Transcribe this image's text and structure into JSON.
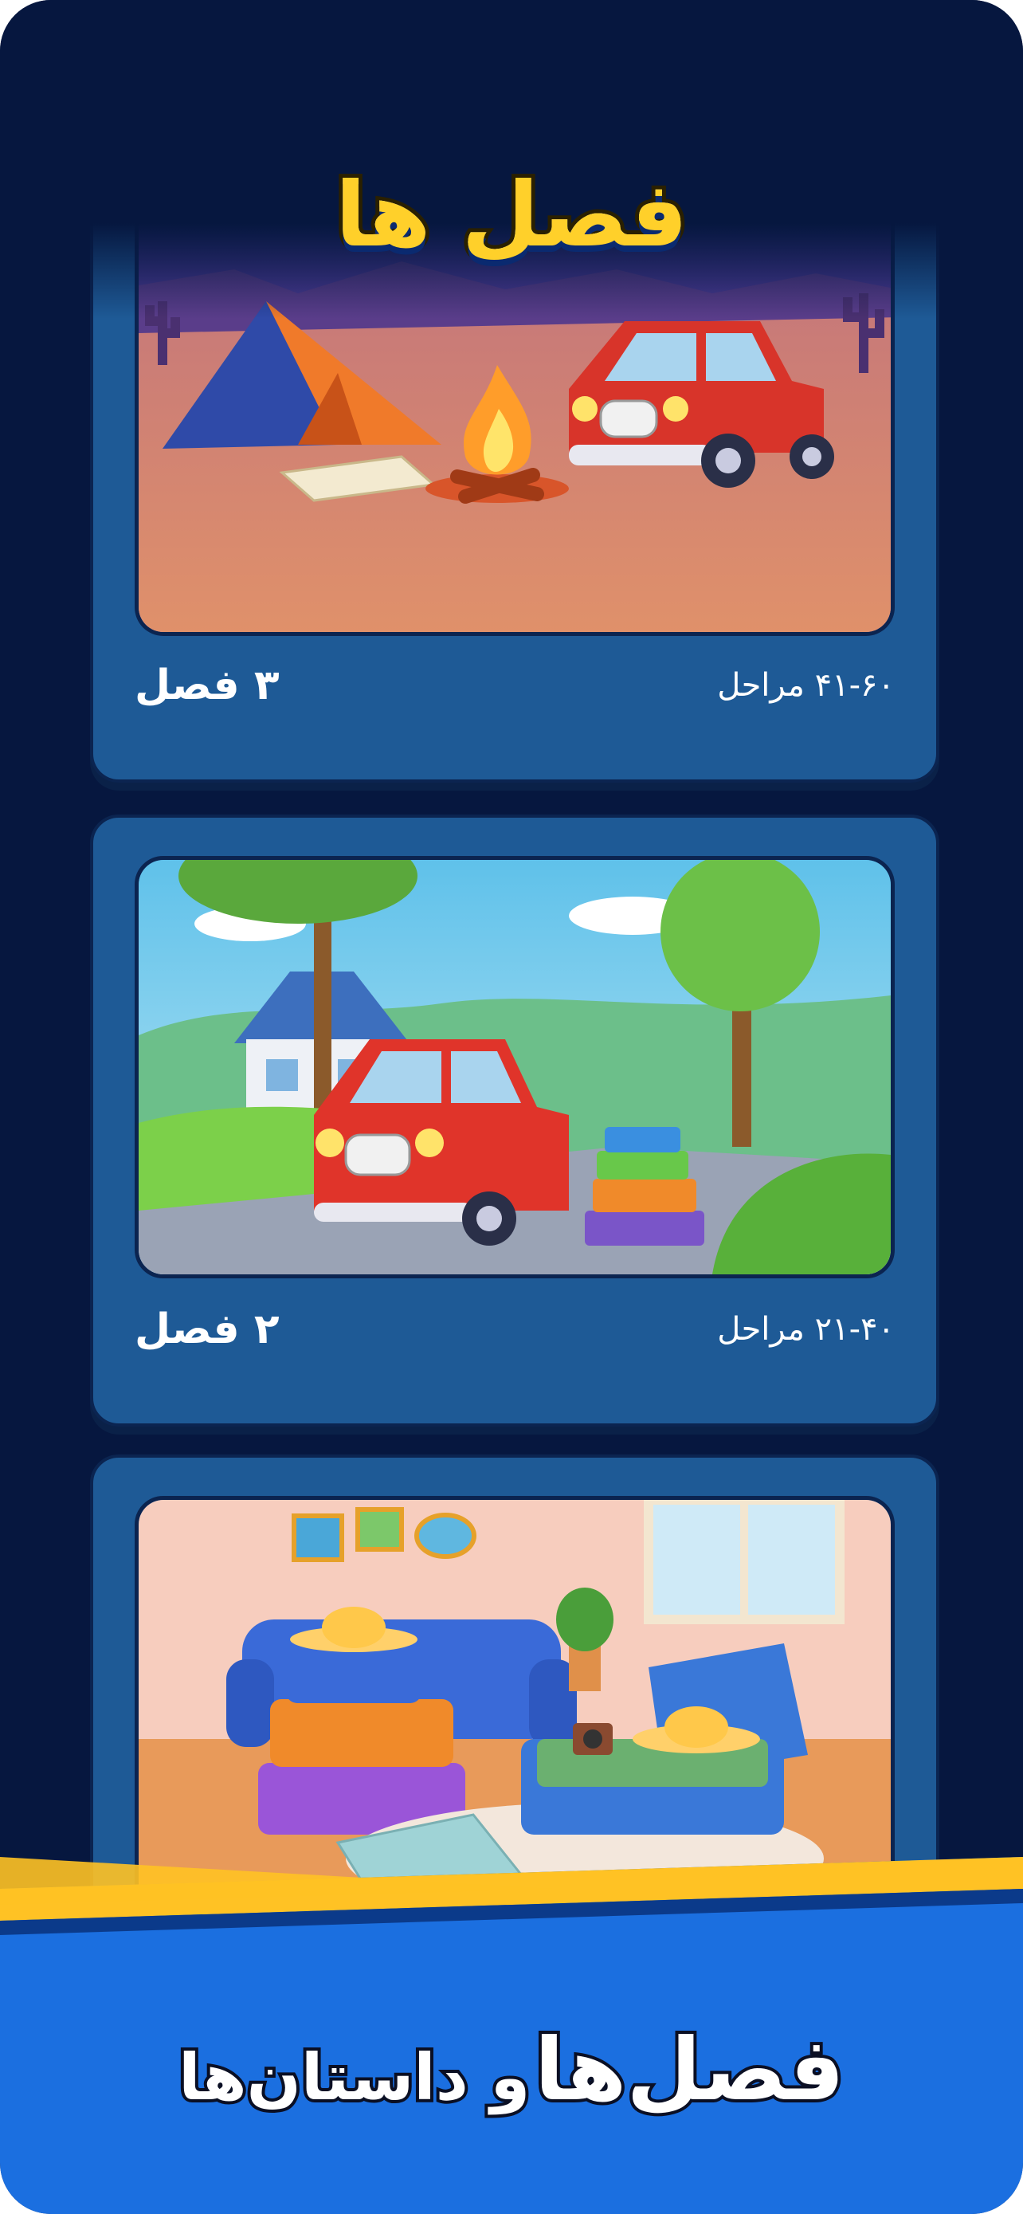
{
  "header": {
    "title": "فصل ها"
  },
  "chapters": [
    {
      "chapter_label": "۳ فصل",
      "levels_label": "۴۱-۶۰ مراحل",
      "scene": "camping-desert-scene"
    },
    {
      "chapter_label": "۲ فصل",
      "levels_label": "۲۱-۴۰ مراحل",
      "scene": "house-car-luggage-scene"
    },
    {
      "chapter_label": "",
      "levels_label": "",
      "scene": "living-room-packing-scene"
    }
  ],
  "footer": {
    "title_big": "فصل‌ها",
    "title_small": "و داستان‌ها"
  },
  "colors": {
    "background": "#06173f",
    "card": "#1e5a96",
    "accent_yellow": "#ffd02a",
    "banner_blue": "#1b6fe0"
  }
}
